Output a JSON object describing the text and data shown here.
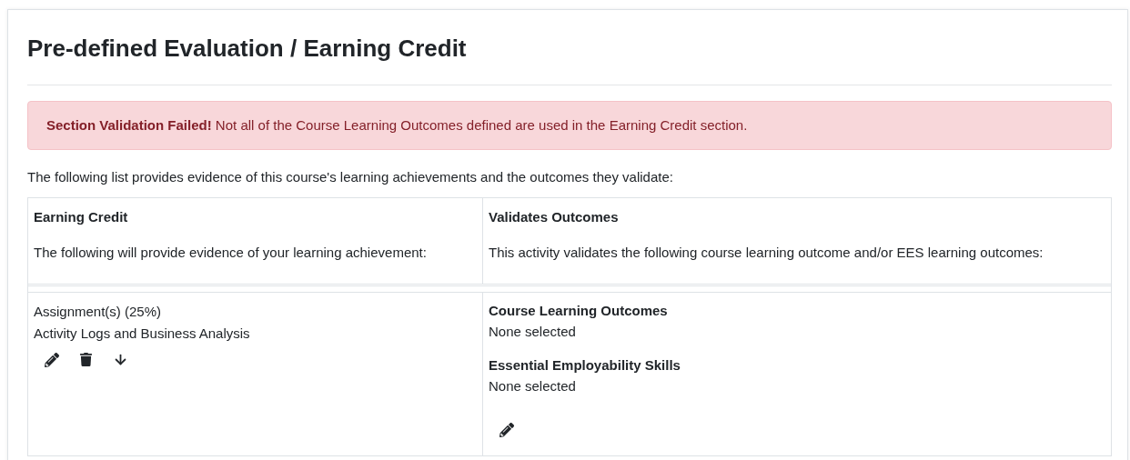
{
  "title": "Pre-defined Evaluation / Earning Credit",
  "alert": {
    "text": "**Section Validation Failed!** Not all of the Course Learning Outcomes defined are used in the Earning Credit section."
  },
  "intro": "The following list provides evidence of this course's learning achievements and the outcomes they validate:",
  "table": {
    "columns": [
      {
        "heading": "Earning Credit",
        "description": "The following will provide evidence of your learning achievement:"
      },
      {
        "heading": "Validates Outcomes",
        "description": "This activity validates the following course learning outcome and/or EES learning outcomes:"
      }
    ],
    "rows": [
      {
        "activity": "Assignment(s) (25%)",
        "name": "Activity Logs and Business Analysis",
        "actions": [
          {
            "kind": "edit"
          },
          {
            "kind": "delete"
          },
          {
            "kind": "move-down"
          }
        ],
        "outcomes": [
          {
            "heading": "Course Learning Outcomes",
            "value": "None selected"
          },
          {
            "heading": "Essential Employability Skills",
            "value": "None selected"
          }
        ],
        "outcome_actions": [
          {
            "kind": "edit"
          }
        ]
      }
    ]
  }
}
